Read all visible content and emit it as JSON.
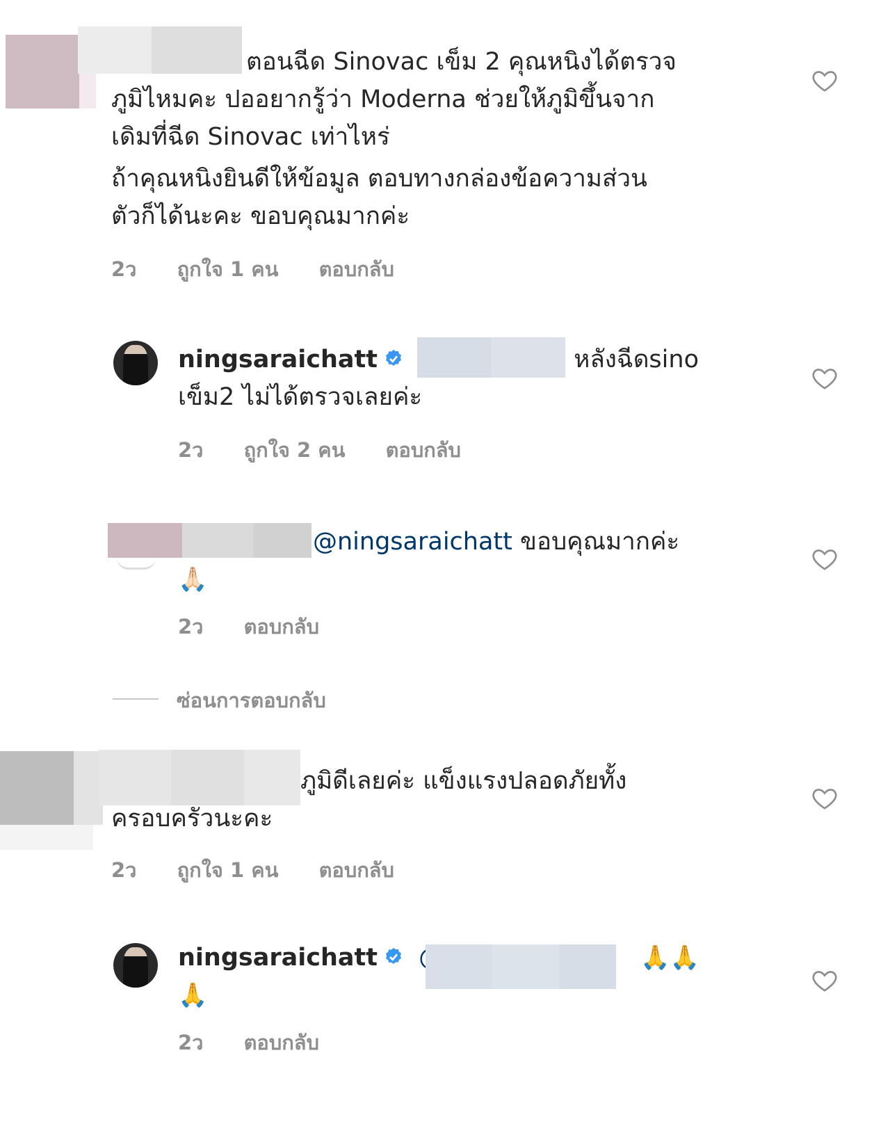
{
  "comments": [
    {
      "lines": [
        "ตอนฉีด Sinovac เข็ม 2 คุณหนิงได้ตรวจ",
        "ภูมิไหมคะ ปออยากรู้ว่า Moderna ช่วยให้ภูมิขึ้นจาก",
        "เดิมที่ฉีด Sinovac เท่าไหร่",
        "ถ้าคุณหนิงยินดีให้ข้อมูล ตอบทางกล่องข้อความส่วน",
        "ตัวก็ได้นะคะ ขอบคุณมากค่ะ"
      ],
      "time": "2ว",
      "likes": "ถูกใจ 1 คน",
      "reply": "ตอบกลับ"
    },
    {
      "username": "ningsaraichatt",
      "text_line1": "หลังฉีดsino",
      "text_line2": "เข็ม2 ไม่ได้ตรวจเลยค่ะ",
      "time": "2ว",
      "likes": "ถูกใจ 2 คน",
      "reply": "ตอบกลับ"
    },
    {
      "mention": "@ningsaraichatt",
      "text": "ขอบคุณมากค่ะ",
      "emoji_line2": "🙏🏻",
      "time": "2ว",
      "reply": "ตอบกลับ"
    },
    {
      "line1": "ภูมิดีเลยค่ะ  แข็งแรงปลอดภัยทั้ง",
      "line2": "ครอบครัวนะคะ",
      "time": "2ว",
      "likes": "ถูกใจ 1 คน",
      "reply": "ตอบกลับ"
    },
    {
      "username": "ningsaraichatt",
      "mention_start": "@",
      "emoji_line1": "🙏🙏",
      "emoji_line2": "🙏",
      "time": "2ว",
      "reply": "ตอบกลับ"
    }
  ],
  "hide_replies": "ซ่อนการตอบกลับ",
  "icons": {
    "like": "heart-outline-icon",
    "verified": "verified-badge-icon"
  },
  "colors": {
    "text": "#262626",
    "meta": "#8e8e8e",
    "mention": "#00376b",
    "verified": "#3897f0"
  }
}
